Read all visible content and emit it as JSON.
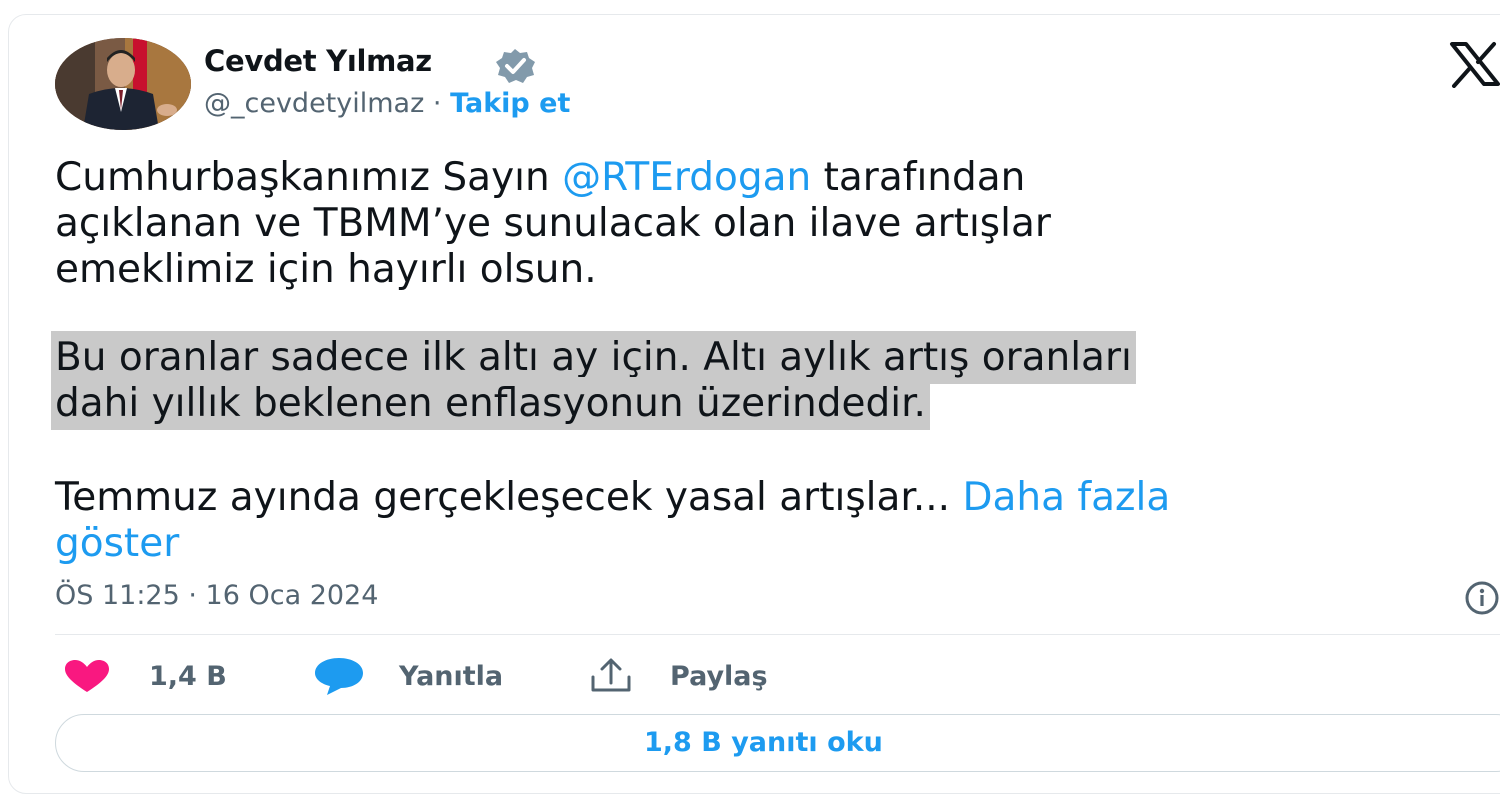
{
  "author": {
    "name": "Cevdet Yılmaz",
    "handle": "@_cevdetyilmaz",
    "separator": "·",
    "follow_label": "Takip et",
    "verified_icon": "verified-badge-icon"
  },
  "tweet": {
    "p1_before": "Cumhurbaşkanımız Sayın ",
    "mention": "@RTErdogan",
    "p1_l1_after": " tarafından",
    "p1_l2": "açıklanan ve TBMM’ye sunulacak olan ilave artışlar",
    "p1_l3": "emeklimiz için hayırlı olsun.",
    "p2_l1": "Bu oranlar sadece ilk altı ay için. Altı aylık artış oranları",
    "p2_l2": "dahi yıllık beklenen enflasyonun üzerindedir.",
    "p3_text": "Temmuz ayında gerçekleşecek yasal artışlar... ",
    "more_l1": "Daha fazla",
    "more_l2": "göster",
    "timestamp": "ÖS 11:25 · 16 Oca 2024"
  },
  "actions": {
    "like_count": "1,4 B",
    "reply_label": "Yanıtla",
    "share_label": "Paylaş"
  },
  "read_replies_label": "1,8 B yanıtı oku",
  "colors": {
    "accent": "#1d9bf0",
    "like": "#f91880",
    "text": "#0f1419",
    "muted": "#536471",
    "highlight": "#c9c9c9"
  }
}
